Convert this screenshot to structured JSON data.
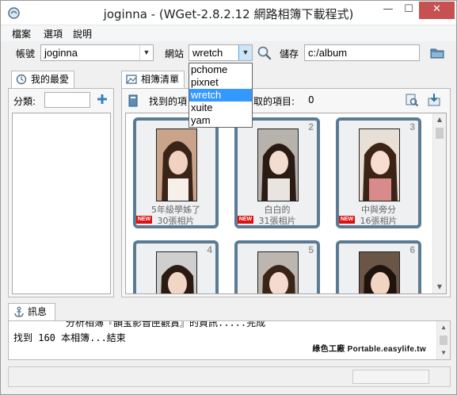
{
  "window": {
    "title": "joginna - (WGet-2.8.2.12 網路相簿下載程式)",
    "minimize_glyph": "—",
    "maximize_glyph": "☐",
    "close_glyph": "✕"
  },
  "menu": [
    "檔案",
    "選項",
    "說明"
  ],
  "toolbar": {
    "account_label": "帳號",
    "account_value": "joginna",
    "site_label": "網站",
    "site_value": "wretch",
    "save_label": "儲存",
    "save_path": "c:/album"
  },
  "site_options": [
    "pchome",
    "pixnet",
    "wretch",
    "xuite",
    "yam"
  ],
  "site_selected_index": 2,
  "favorites": {
    "tab_label": "我的最愛",
    "category_label": "分類:"
  },
  "albums": {
    "tab_label": "相簿清單",
    "found_label": "找到的項",
    "selected_label": "取的項目:",
    "selected_count": "0",
    "items": [
      {
        "num": "2",
        "title": "白白的",
        "count": "31張相片",
        "is_new": true
      },
      {
        "num": "3",
        "title": "中與旁分",
        "count": "16張相片",
        "is_new": true
      },
      {
        "num": "4",
        "title": "",
        "count": "",
        "is_new": false
      },
      {
        "num": "5",
        "title": "",
        "count": "",
        "is_new": false
      },
      {
        "num": "6",
        "title": "",
        "count": "",
        "is_new": false
      }
    ],
    "first_item": {
      "title": "5年級學姊了",
      "count": "30張相片",
      "is_new": true
    },
    "new_badge": "NEW"
  },
  "messages": {
    "tab_label": "訊息",
    "lines": [
      "分析相簿『韻宝影音匣觀賞』的資訊.....完成",
      "找到 160 本相簿...結束"
    ]
  },
  "watermark": "綠色工廠 Portable.easylife.tw",
  "colors": {
    "album_frame": "#5b7b94",
    "selection": "#3399ff",
    "close_button": "#c75050",
    "new_badge": "#dd1111"
  }
}
